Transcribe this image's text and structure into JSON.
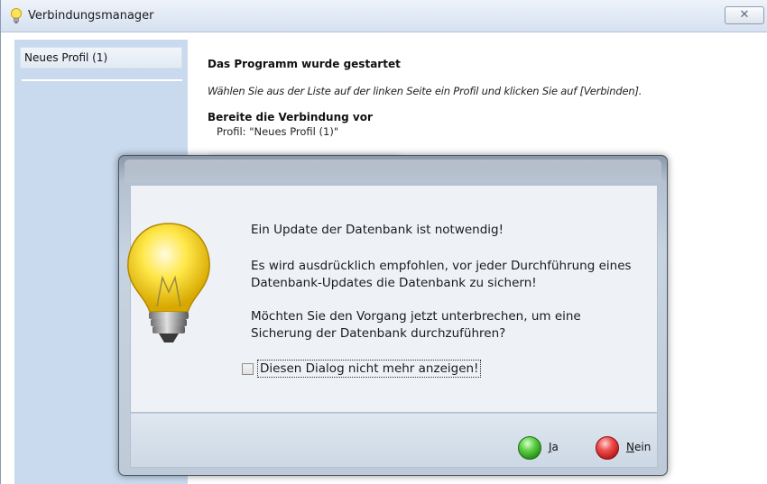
{
  "window": {
    "title": "Verbindungsmanager",
    "close_label": "✕"
  },
  "sidebar": {
    "items": [
      {
        "label": "Neues Profil (1)"
      }
    ]
  },
  "content": {
    "heading1": "Das Programm wurde gestartet",
    "instruction": "Wählen Sie aus der Liste auf der linken Seite ein Profil und klicken Sie auf [Verbinden].",
    "heading2": "Bereite die Verbindung vor",
    "profile_line": "Profil: \"Neues Profil (1)\""
  },
  "dialog": {
    "line1": "Ein Update der Datenbank ist notwendig!",
    "line2a": "Es wird ausdrücklich empfohlen, vor jeder Durchführung eines",
    "line2b": "Datenbank-Updates die Datenbank zu sichern!",
    "line3a": "Möchten Sie den Vorgang jetzt unterbrechen, um eine",
    "line3b": "Sicherung der Datenbank durchzuführen?",
    "checkbox_label": "Diesen Dialog nicht mehr anzeigen!",
    "checkbox_checked": false,
    "yes": {
      "underlined": "J",
      "rest": "a"
    },
    "no": {
      "underlined": "N",
      "rest": "ein"
    }
  },
  "colors": {
    "sidebar_bg": "#c9daee",
    "yes_orb": "#3fb82b",
    "no_orb": "#d42a2a"
  },
  "icons": {
    "title": "lightbulb-icon",
    "dialog": "lightbulb-icon",
    "yes": "green-orb-icon",
    "no": "red-orb-icon"
  }
}
